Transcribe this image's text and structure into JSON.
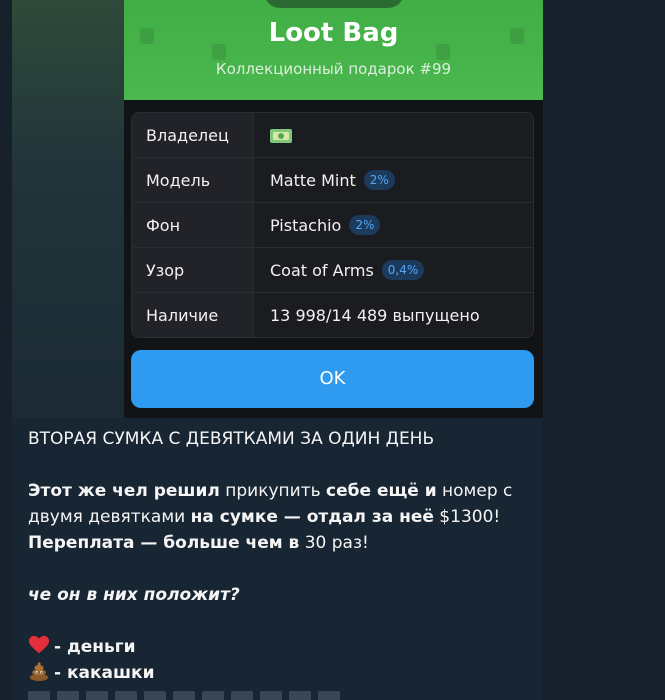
{
  "colors": {
    "chat_background": "#17212b",
    "bubble_background": "#182533",
    "hero_green": "#4cb84f",
    "ok_button": "#2e9bf0",
    "rarity_text": "#52a7f7"
  },
  "gift_card": {
    "title": "Loot Bag",
    "subtitle": "Коллекционный подарок #99",
    "rows": [
      {
        "key": "Владелец",
        "value": "",
        "icon": "money-bills-icon"
      },
      {
        "key": "Модель",
        "value": "Matte Mint",
        "rarity": "2%"
      },
      {
        "key": "Фон",
        "value": "Pistachio",
        "rarity": "2%"
      },
      {
        "key": "Узор",
        "value": "Coat of Arms",
        "rarity": "0,4%"
      },
      {
        "key": "Наличие",
        "value": "13 998/14 489 выпущено"
      }
    ],
    "ok_label": "OK"
  },
  "caption": {
    "headline": "ВТОРАЯ СУМКА С ДЕВЯТКАМИ ЗА ОДИН ДЕНЬ",
    "p1": {
      "s1": "Этот же чел решил",
      "s2": " прикупить ",
      "s3": "себе ещё и",
      "s4": " номер с двумя девятками ",
      "s5": "на сумке — отдал за неё",
      "s6": " $1300! ",
      "s7": "Переплата — больше чем в",
      "s8": " 30 раз!"
    },
    "question": "че он в них положит?",
    "legend": [
      {
        "icon": "red-heart-icon",
        "text": "- деньги"
      },
      {
        "icon": "pile-of-poo-icon",
        "text": "- какашки"
      }
    ]
  }
}
